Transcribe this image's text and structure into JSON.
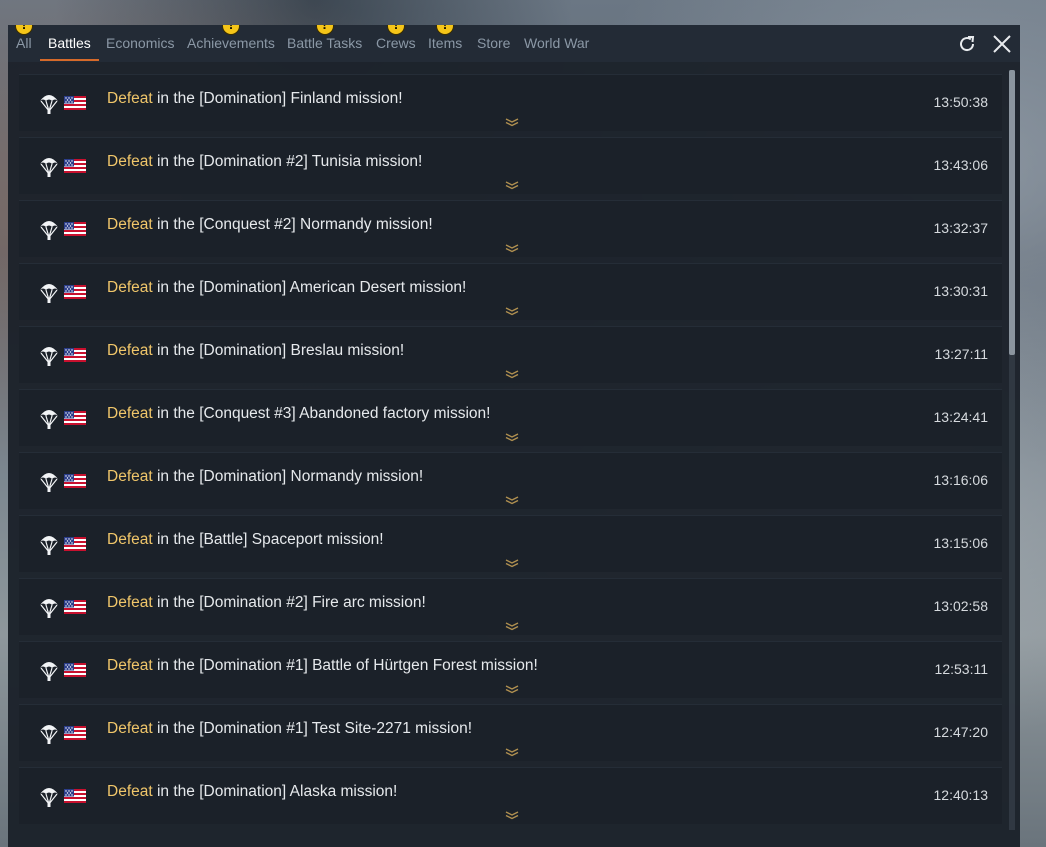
{
  "colors": {
    "accent": "#d66a2a",
    "result": "#f0c66a",
    "alert": "#f5c518"
  },
  "tabs": [
    {
      "label": "All",
      "alert": true
    },
    {
      "label": "Battles",
      "alert": false,
      "active": true
    },
    {
      "label": "Economics",
      "alert": false
    },
    {
      "label": "Achievements",
      "alert": true
    },
    {
      "label": "Battle Tasks",
      "alert": true
    },
    {
      "label": "Crews",
      "alert": true
    },
    {
      "label": "Items",
      "alert": true
    },
    {
      "label": "Store",
      "alert": false
    },
    {
      "label": "World War",
      "alert": false
    }
  ],
  "alert_glyph": "!",
  "controls": {
    "refresh_icon": "refresh-icon",
    "close_icon": "close-icon"
  },
  "messages": [
    {
      "result": "Defeat",
      "text": " in the [Domination] Finland mission!",
      "time": "13:50:38"
    },
    {
      "result": "Defeat",
      "text": " in the [Domination #2] Tunisia mission!",
      "time": "13:43:06"
    },
    {
      "result": "Defeat",
      "text": " in the [Conquest #2] Normandy mission!",
      "time": "13:32:37"
    },
    {
      "result": "Defeat",
      "text": " in the [Domination] American Desert mission!",
      "time": "13:30:31"
    },
    {
      "result": "Defeat",
      "text": " in the [Domination] Breslau mission!",
      "time": "13:27:11"
    },
    {
      "result": "Defeat",
      "text": " in the [Conquest #3] Abandoned factory mission!",
      "time": "13:24:41"
    },
    {
      "result": "Defeat",
      "text": " in the [Domination] Normandy mission!",
      "time": "13:16:06"
    },
    {
      "result": "Defeat",
      "text": " in the [Battle] Spaceport mission!",
      "time": "13:15:06"
    },
    {
      "result": "Defeat",
      "text": " in the [Domination #2] Fire arc mission!",
      "time": "13:02:58"
    },
    {
      "result": "Defeat",
      "text": " in the [Domination #1] Battle of Hürtgen Forest mission!",
      "time": "12:53:11"
    },
    {
      "result": "Defeat",
      "text": " in the [Domination #1] Test Site-2271 mission!",
      "time": "12:47:20"
    },
    {
      "result": "Defeat",
      "text": " in the [Domination] Alaska mission!",
      "time": "12:40:13"
    }
  ]
}
